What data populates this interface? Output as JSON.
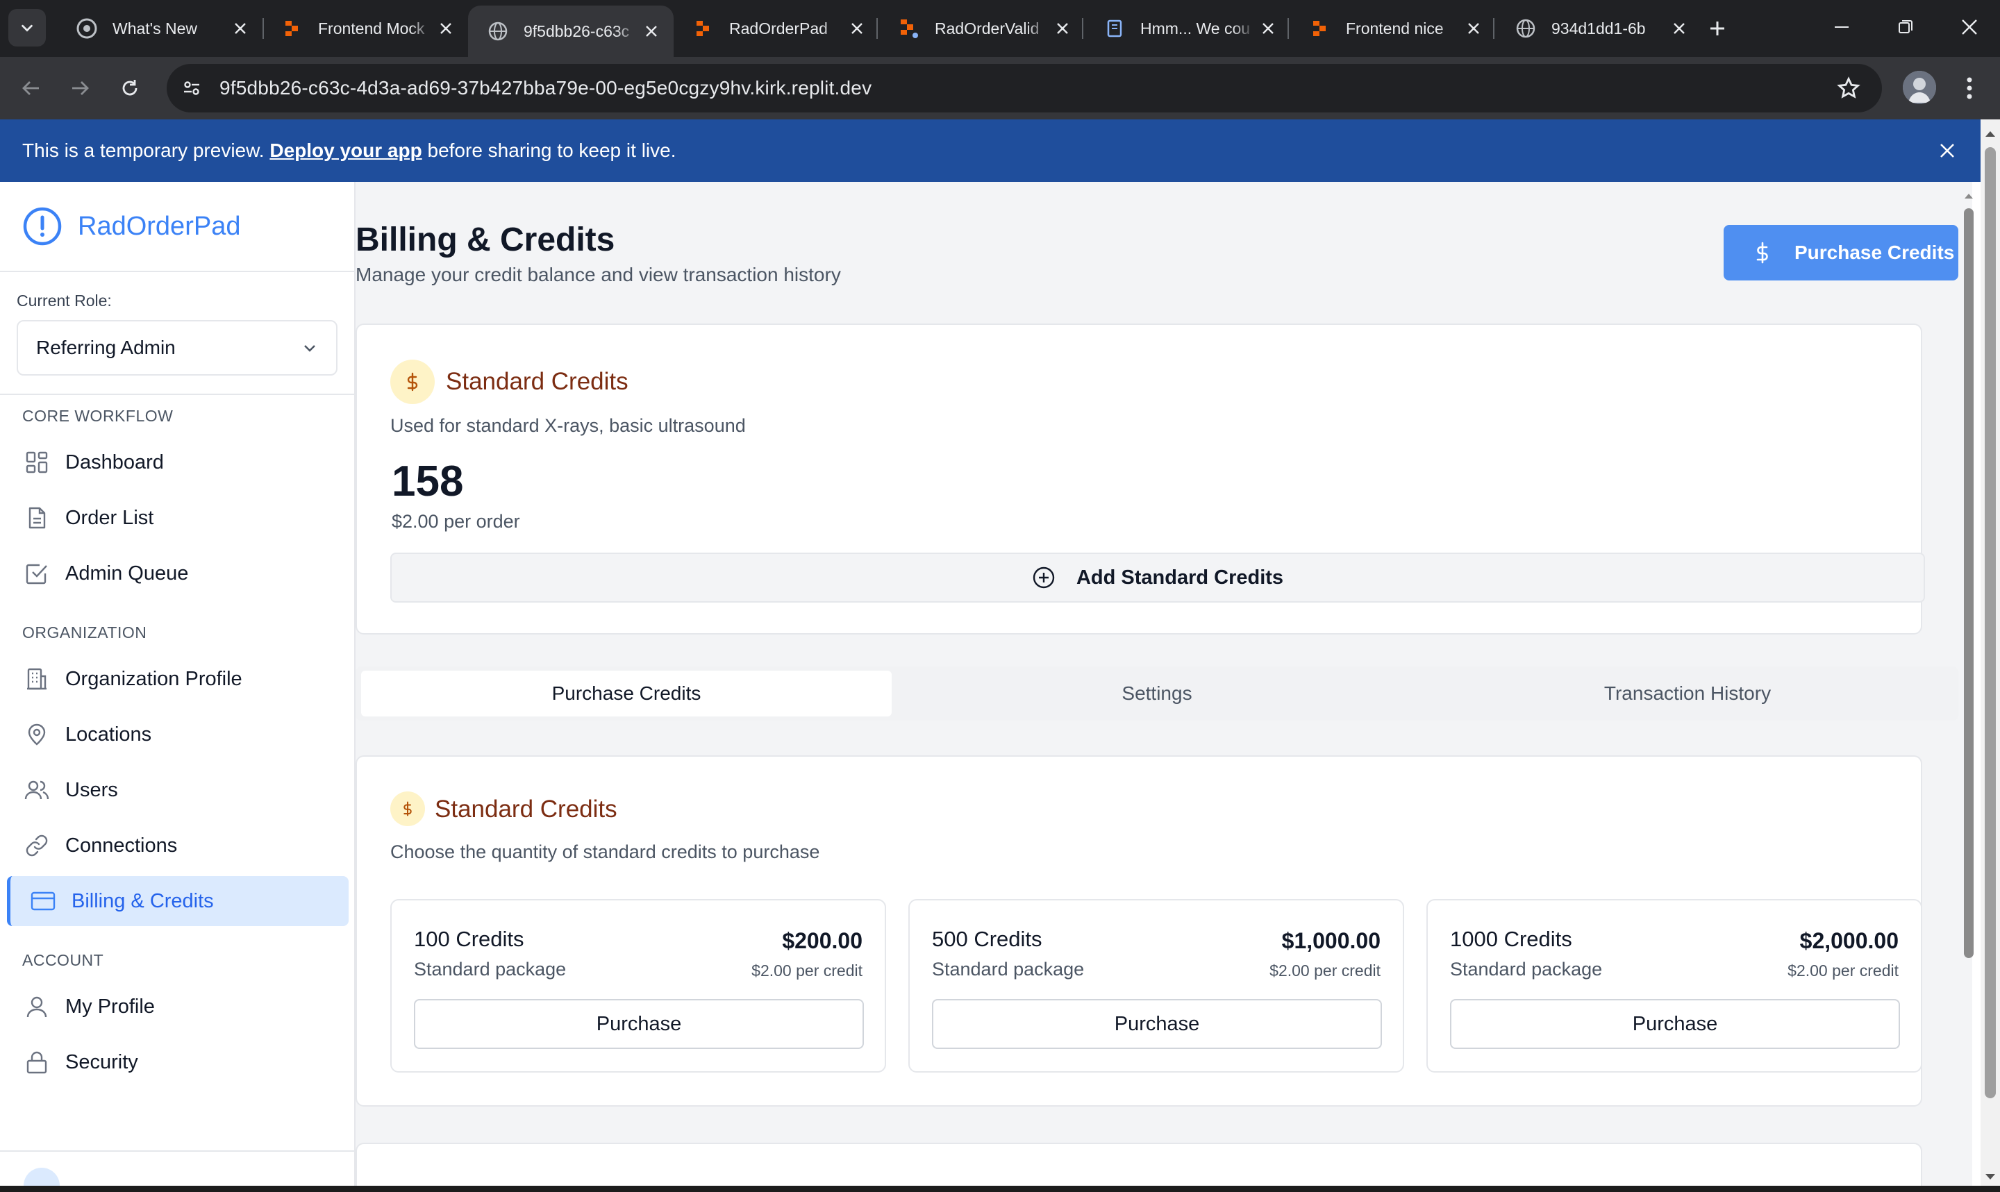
{
  "browser": {
    "tabs": [
      {
        "title": "What's New",
        "icon": "chrome-icon"
      },
      {
        "title": "Frontend Mock",
        "icon": "replit-icon"
      },
      {
        "title": "9f5dbb26-c63c",
        "icon": "globe-icon",
        "active": true
      },
      {
        "title": "RadOrderPad",
        "icon": "replit-icon"
      },
      {
        "title": "RadOrderValid",
        "icon": "replit-icon"
      },
      {
        "title": "Hmm... We cou",
        "icon": "page-icon"
      },
      {
        "title": "Frontend nice",
        "icon": "replit-icon"
      },
      {
        "title": "934d1dd1-6b",
        "icon": "globe-icon"
      }
    ],
    "url": "9f5dbb26-c63c-4d3a-ad69-37b427bba79e-00-eg5e0cgzy9hv.kirk.replit.dev"
  },
  "banner": {
    "prefix": "This is a temporary preview. ",
    "link": "Deploy your app",
    "suffix": " before sharing to keep it live."
  },
  "sidebar": {
    "brand": "RadOrderPad",
    "role_label": "Current Role:",
    "role_value": "Referring Admin",
    "sections": {
      "core": "CORE WORKFLOW",
      "org": "ORGANIZATION",
      "account": "ACCOUNT"
    },
    "items": {
      "dashboard": "Dashboard",
      "order_list": "Order List",
      "admin_queue": "Admin Queue",
      "org_profile": "Organization Profile",
      "locations": "Locations",
      "users": "Users",
      "connections": "Connections",
      "billing": "Billing & Credits",
      "my_profile": "My Profile",
      "security": "Security"
    }
  },
  "page": {
    "title": "Billing & Credits",
    "subtitle": "Manage your credit balance and view transaction history",
    "purchase_button": "Purchase Credits"
  },
  "balance": {
    "heading": "Standard Credits",
    "description": "Used for standard X-rays, basic ultrasound",
    "count": "158",
    "rate": "$2.00 per order",
    "add_button": "Add Standard Credits"
  },
  "tabs": {
    "purchase": "Purchase Credits",
    "settings": "Settings",
    "history": "Transaction History"
  },
  "packages": {
    "heading": "Standard Credits",
    "description": "Choose the quantity of standard credits to purchase",
    "button_label": "Purchase",
    "items": [
      {
        "name": "100 Credits",
        "sub": "Standard package",
        "price": "$200.00",
        "rate": "$2.00 per credit"
      },
      {
        "name": "500 Credits",
        "sub": "Standard package",
        "price": "$1,000.00",
        "rate": "$2.00 per credit"
      },
      {
        "name": "1000 Credits",
        "sub": "Standard package",
        "price": "$2,000.00",
        "rate": "$2.00 per credit"
      }
    ]
  },
  "colors": {
    "brand_blue": "#3b82f6",
    "banner_blue": "#1f4e9c",
    "credit_heading": "#7c2d12",
    "coin_bg": "#fef3c7"
  }
}
